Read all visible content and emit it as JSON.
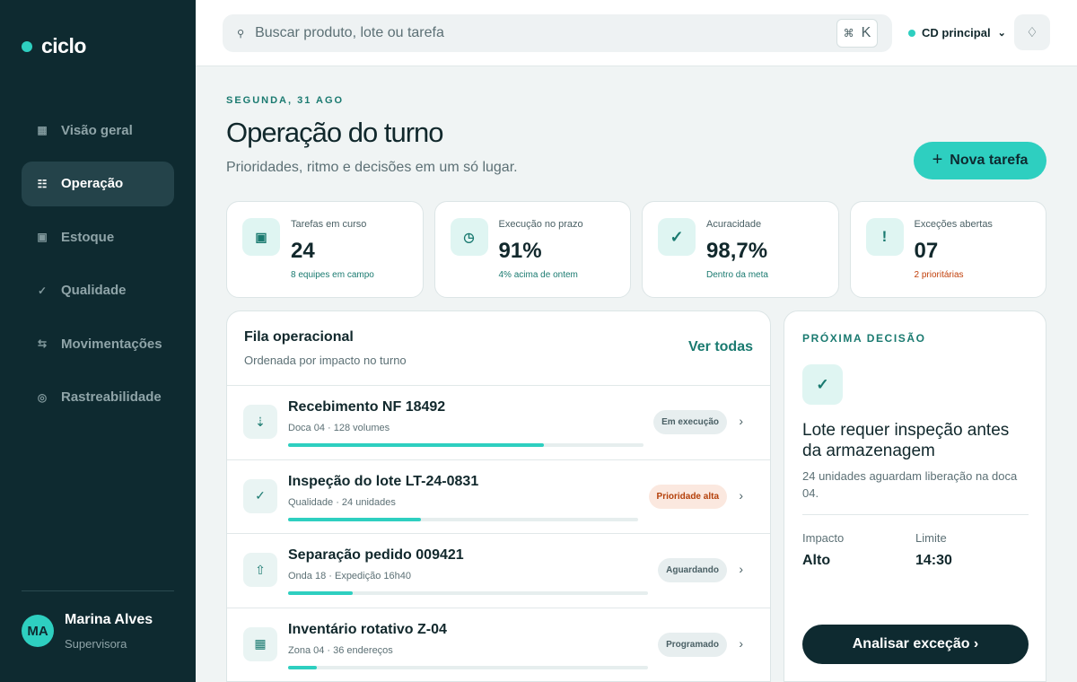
{
  "brand": {
    "name": "ciclo"
  },
  "sidebar": {
    "items": [
      {
        "label": "Visão geral",
        "icon": "grid-icon"
      },
      {
        "label": "Operação",
        "icon": "list-icon",
        "active": true
      },
      {
        "label": "Estoque",
        "icon": "box-icon"
      },
      {
        "label": "Qualidade",
        "icon": "check-icon"
      },
      {
        "label": "Movimentações",
        "icon": "swap-icon"
      },
      {
        "label": "Rastreabilidade",
        "icon": "target-icon"
      }
    ]
  },
  "user": {
    "initials": "MA",
    "name": "Marina Alves",
    "role": "Supervisora"
  },
  "search": {
    "placeholder": "Buscar produto, lote ou tarefa",
    "value": "",
    "shortcut_symbol": "⌘",
    "shortcut_key": "K"
  },
  "site": {
    "label": "CD principal"
  },
  "page": {
    "date": "SEGUNDA, 31 AGO",
    "title": "Operação do turno",
    "subtitle": "Prioridades, ritmo e decisões em um só lugar.",
    "primary_action": "Nova tarefa"
  },
  "kpis": [
    {
      "label": "Tarefas em curso",
      "value": "24",
      "note": "8 equipes em campo",
      "icon": "task-icon",
      "tone": "ok"
    },
    {
      "label": "Execução no prazo",
      "value": "91%",
      "note": "4% acima de ontem",
      "icon": "clock-icon",
      "tone": "ok"
    },
    {
      "label": "Acuracidade",
      "value": "98,7%",
      "note": "Dentro da meta",
      "icon": "check-icon",
      "tone": "ok"
    },
    {
      "label": "Exceções abertas",
      "value": "07",
      "note": "2 prioritárias",
      "icon": "alert-icon",
      "tone": "warn"
    }
  ],
  "queue": {
    "title": "Fila operacional",
    "subtitle": "Ordenada por impacto no turno",
    "view_all": "Ver todas",
    "rows": [
      {
        "title": "Recebimento NF 18492",
        "meta": "Doca 04 · 128 volumes",
        "status": "Em execução",
        "status_tone": "neutral",
        "progress": 0.72,
        "icon": "arrow-down-icon"
      },
      {
        "title": "Inspeção do lote LT-24-0831",
        "meta": "Qualidade · 24 unidades",
        "status": "Prioridade alta",
        "status_tone": "hot",
        "progress": 0.38,
        "icon": "check-icon"
      },
      {
        "title": "Separação pedido 009421",
        "meta": "Onda 18 · Expedição 16h40",
        "status": "Aguardando",
        "status_tone": "neutral",
        "progress": 0.18,
        "icon": "arrow-up-icon"
      },
      {
        "title": "Inventário rotativo Z-04",
        "meta": "Zona 04 · 36 endereços",
        "status": "Programado",
        "status_tone": "neutral",
        "progress": 0.08,
        "icon": "grid-icon"
      }
    ]
  },
  "decision": {
    "kicker": "PRÓXIMA DECISÃO",
    "title": "Lote requer inspeção antes da armazenagem",
    "description": "24 unidades aguardam liberação na doca 04.",
    "impact_label": "Impacto",
    "impact_value": "Alto",
    "limit_label": "Limite",
    "limit_value": "14:30",
    "action": "Analisar exceção ›"
  },
  "colors": {
    "accent": "#2ecfc0",
    "sidebar": "#0e2a30",
    "accent_dark": "#1a7a70",
    "warn": "#c2410c"
  }
}
